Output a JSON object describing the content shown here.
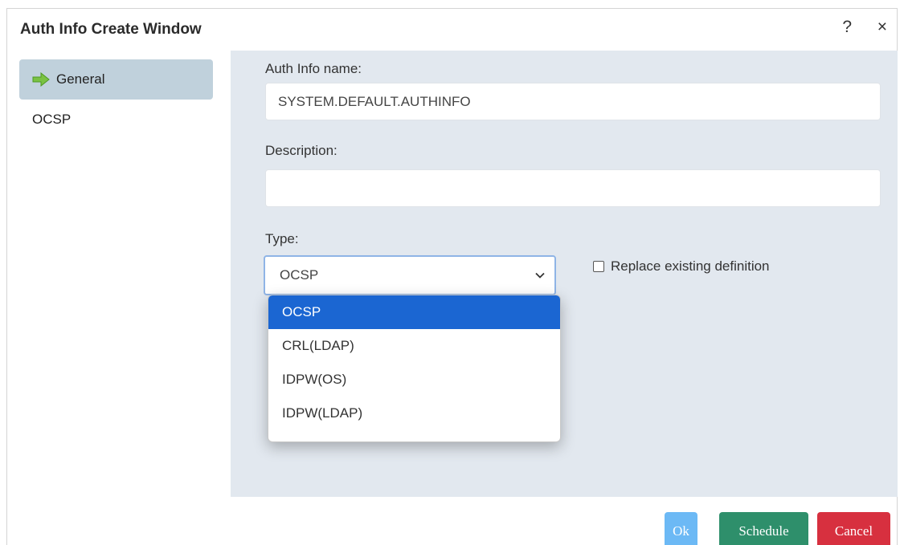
{
  "window": {
    "title": "Auth Info Create Window",
    "help": "?",
    "close": "×"
  },
  "sidebar": {
    "items": [
      {
        "label": "General",
        "active": true,
        "icon": "arrow-right-icon"
      },
      {
        "label": "OCSP",
        "active": false
      }
    ]
  },
  "form": {
    "name_label": "Auth Info name:",
    "name_value": "SYSTEM.DEFAULT.AUTHINFO",
    "description_label": "Description:",
    "description_value": "",
    "type_label": "Type:",
    "type_value": "OCSP",
    "replace_label": "Replace existing definition",
    "replace_checked": false
  },
  "type_dropdown": {
    "options": [
      "OCSP",
      "CRL(LDAP)",
      "IDPW(OS)",
      "IDPW(LDAP)"
    ],
    "selected": "OCSP"
  },
  "buttons": {
    "ok": "Ok",
    "schedule": "Schedule",
    "cancel": "Cancel"
  },
  "colors": {
    "selected_option": "#1b66d2",
    "ok": "#6cb9f5",
    "schedule": "#2e8f6b",
    "cancel": "#d7303f",
    "sidebar_active": "#c0d1dc",
    "content_bg": "#e2e8ef",
    "arrow_icon": "#7ac243"
  }
}
